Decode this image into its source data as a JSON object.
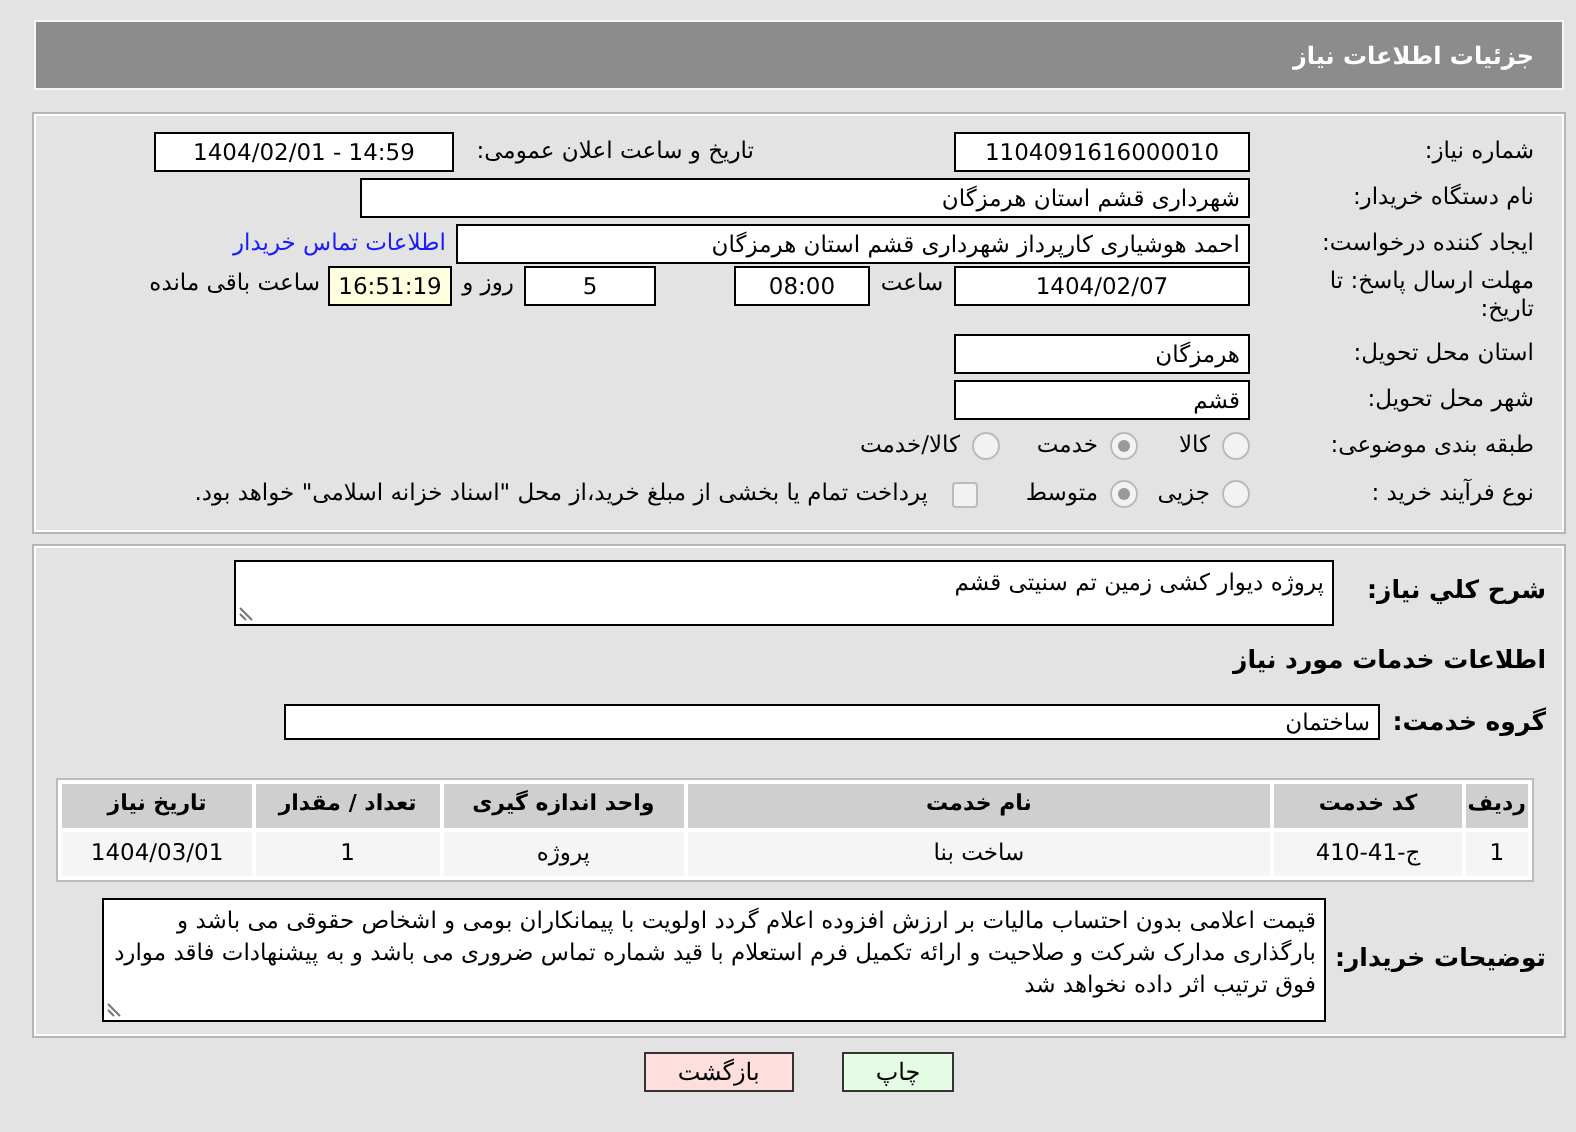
{
  "header": {
    "title": "جزئیات اطلاعات نیاز"
  },
  "need_number": {
    "label": "شماره نیاز:",
    "value": "1104091616000010"
  },
  "announce": {
    "label": "تاریخ و ساعت اعلان عمومی:",
    "value": "1404/02/01 - 14:59"
  },
  "buyer_org": {
    "label": "نام دستگاه خریدار:",
    "value": "شهرداری قشم استان هرمزگان"
  },
  "requester": {
    "label": "ایجاد کننده درخواست:",
    "value": "احمد هوشیاری کارپرداز شهرداری قشم استان هرمزگان",
    "contact_link": "اطلاعات تماس خریدار"
  },
  "deadline": {
    "label": "مهلت ارسال پاسخ: تا تاریخ:",
    "date": "1404/02/07",
    "time_label": "ساعت",
    "time": "08:00",
    "days": "5",
    "days_label": "روز و",
    "remaining": "16:51:19",
    "remaining_label": "ساعت باقی مانده"
  },
  "province": {
    "label": "استان محل تحویل:",
    "value": "هرمزگان"
  },
  "city": {
    "label": "شهر محل تحویل:",
    "value": "قشم"
  },
  "category": {
    "label": "طبقه بندی موضوعی:",
    "options": [
      {
        "label": "کالا",
        "selected": false
      },
      {
        "label": "خدمت",
        "selected": true
      },
      {
        "label": "کالا/خدمت",
        "selected": false
      }
    ]
  },
  "process": {
    "label": "نوع فرآیند خرید :",
    "options": [
      {
        "label": "جزیی",
        "selected": false
      },
      {
        "label": "متوسط",
        "selected": true
      }
    ],
    "payment": {
      "checked": false,
      "label": "پرداخت تمام یا بخشی از مبلغ خرید،از محل \"اسناد خزانه اسلامی\" خواهد بود."
    }
  },
  "description": {
    "label": "شرح کلي نياز:",
    "value": "پروژه دیوار کشی زمین تم سنیتی قشم"
  },
  "services_title": "اطلاعات خدمات مورد نیاز",
  "service_group": {
    "label": "گروه خدمت:",
    "value": "ساختمان"
  },
  "table": {
    "columns": [
      "ردیف",
      "کد خدمت",
      "نام خدمت",
      "واحد اندازه گیری",
      "تعداد / مقدار",
      "تاریخ نیاز"
    ],
    "rows": [
      [
        "1",
        "ج-41-410",
        "ساخت بنا",
        "پروژه",
        "1",
        "1404/03/01"
      ]
    ]
  },
  "buyer_notes": {
    "label": "توضیحات خریدار:",
    "value": "قیمت اعلامی بدون احتساب مالیات بر ارزش افزوده اعلام گردد اولویت با پیمانکاران بومی و اشخاص حقوقی می باشد و بارگذاری مدارک شرکت و صلاحیت و ارائه تکمیل فرم استعلام با قید شماره تماس ضروری می باشد و به پیشنهادات فاقد موارد فوق ترتیب اثر داده نخواهد شد"
  },
  "buttons": [
    {
      "label": "چاپ",
      "kind": "print"
    },
    {
      "label": "بازگشت",
      "kind": "back"
    }
  ]
}
